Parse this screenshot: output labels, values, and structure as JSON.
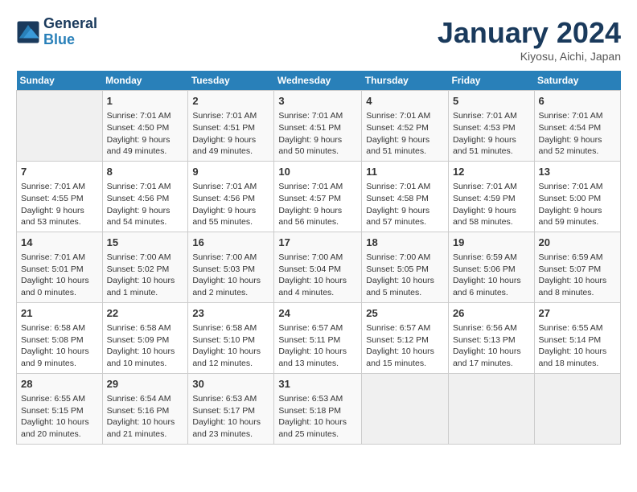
{
  "header": {
    "logo_line1": "General",
    "logo_line2": "Blue",
    "month": "January 2024",
    "location": "Kiyosu, Aichi, Japan"
  },
  "days_of_week": [
    "Sunday",
    "Monday",
    "Tuesday",
    "Wednesday",
    "Thursday",
    "Friday",
    "Saturday"
  ],
  "weeks": [
    [
      {
        "day": "",
        "empty": true
      },
      {
        "day": "1",
        "sunrise": "7:01 AM",
        "sunset": "4:50 PM",
        "daylight": "9 hours and 49 minutes."
      },
      {
        "day": "2",
        "sunrise": "7:01 AM",
        "sunset": "4:51 PM",
        "daylight": "9 hours and 49 minutes."
      },
      {
        "day": "3",
        "sunrise": "7:01 AM",
        "sunset": "4:51 PM",
        "daylight": "9 hours and 50 minutes."
      },
      {
        "day": "4",
        "sunrise": "7:01 AM",
        "sunset": "4:52 PM",
        "daylight": "9 hours and 51 minutes."
      },
      {
        "day": "5",
        "sunrise": "7:01 AM",
        "sunset": "4:53 PM",
        "daylight": "9 hours and 51 minutes."
      },
      {
        "day": "6",
        "sunrise": "7:01 AM",
        "sunset": "4:54 PM",
        "daylight": "9 hours and 52 minutes."
      }
    ],
    [
      {
        "day": "7",
        "sunrise": "7:01 AM",
        "sunset": "4:55 PM",
        "daylight": "9 hours and 53 minutes."
      },
      {
        "day": "8",
        "sunrise": "7:01 AM",
        "sunset": "4:56 PM",
        "daylight": "9 hours and 54 minutes."
      },
      {
        "day": "9",
        "sunrise": "7:01 AM",
        "sunset": "4:56 PM",
        "daylight": "9 hours and 55 minutes."
      },
      {
        "day": "10",
        "sunrise": "7:01 AM",
        "sunset": "4:57 PM",
        "daylight": "9 hours and 56 minutes."
      },
      {
        "day": "11",
        "sunrise": "7:01 AM",
        "sunset": "4:58 PM",
        "daylight": "9 hours and 57 minutes."
      },
      {
        "day": "12",
        "sunrise": "7:01 AM",
        "sunset": "4:59 PM",
        "daylight": "9 hours and 58 minutes."
      },
      {
        "day": "13",
        "sunrise": "7:01 AM",
        "sunset": "5:00 PM",
        "daylight": "9 hours and 59 minutes."
      }
    ],
    [
      {
        "day": "14",
        "sunrise": "7:01 AM",
        "sunset": "5:01 PM",
        "daylight": "10 hours and 0 minutes."
      },
      {
        "day": "15",
        "sunrise": "7:00 AM",
        "sunset": "5:02 PM",
        "daylight": "10 hours and 1 minute."
      },
      {
        "day": "16",
        "sunrise": "7:00 AM",
        "sunset": "5:03 PM",
        "daylight": "10 hours and 2 minutes."
      },
      {
        "day": "17",
        "sunrise": "7:00 AM",
        "sunset": "5:04 PM",
        "daylight": "10 hours and 4 minutes."
      },
      {
        "day": "18",
        "sunrise": "7:00 AM",
        "sunset": "5:05 PM",
        "daylight": "10 hours and 5 minutes."
      },
      {
        "day": "19",
        "sunrise": "6:59 AM",
        "sunset": "5:06 PM",
        "daylight": "10 hours and 6 minutes."
      },
      {
        "day": "20",
        "sunrise": "6:59 AM",
        "sunset": "5:07 PM",
        "daylight": "10 hours and 8 minutes."
      }
    ],
    [
      {
        "day": "21",
        "sunrise": "6:58 AM",
        "sunset": "5:08 PM",
        "daylight": "10 hours and 9 minutes."
      },
      {
        "day": "22",
        "sunrise": "6:58 AM",
        "sunset": "5:09 PM",
        "daylight": "10 hours and 10 minutes."
      },
      {
        "day": "23",
        "sunrise": "6:58 AM",
        "sunset": "5:10 PM",
        "daylight": "10 hours and 12 minutes."
      },
      {
        "day": "24",
        "sunrise": "6:57 AM",
        "sunset": "5:11 PM",
        "daylight": "10 hours and 13 minutes."
      },
      {
        "day": "25",
        "sunrise": "6:57 AM",
        "sunset": "5:12 PM",
        "daylight": "10 hours and 15 minutes."
      },
      {
        "day": "26",
        "sunrise": "6:56 AM",
        "sunset": "5:13 PM",
        "daylight": "10 hours and 17 minutes."
      },
      {
        "day": "27",
        "sunrise": "6:55 AM",
        "sunset": "5:14 PM",
        "daylight": "10 hours and 18 minutes."
      }
    ],
    [
      {
        "day": "28",
        "sunrise": "6:55 AM",
        "sunset": "5:15 PM",
        "daylight": "10 hours and 20 minutes."
      },
      {
        "day": "29",
        "sunrise": "6:54 AM",
        "sunset": "5:16 PM",
        "daylight": "10 hours and 21 minutes."
      },
      {
        "day": "30",
        "sunrise": "6:53 AM",
        "sunset": "5:17 PM",
        "daylight": "10 hours and 23 minutes."
      },
      {
        "day": "31",
        "sunrise": "6:53 AM",
        "sunset": "5:18 PM",
        "daylight": "10 hours and 25 minutes."
      },
      {
        "day": "",
        "empty": true
      },
      {
        "day": "",
        "empty": true
      },
      {
        "day": "",
        "empty": true
      }
    ]
  ]
}
